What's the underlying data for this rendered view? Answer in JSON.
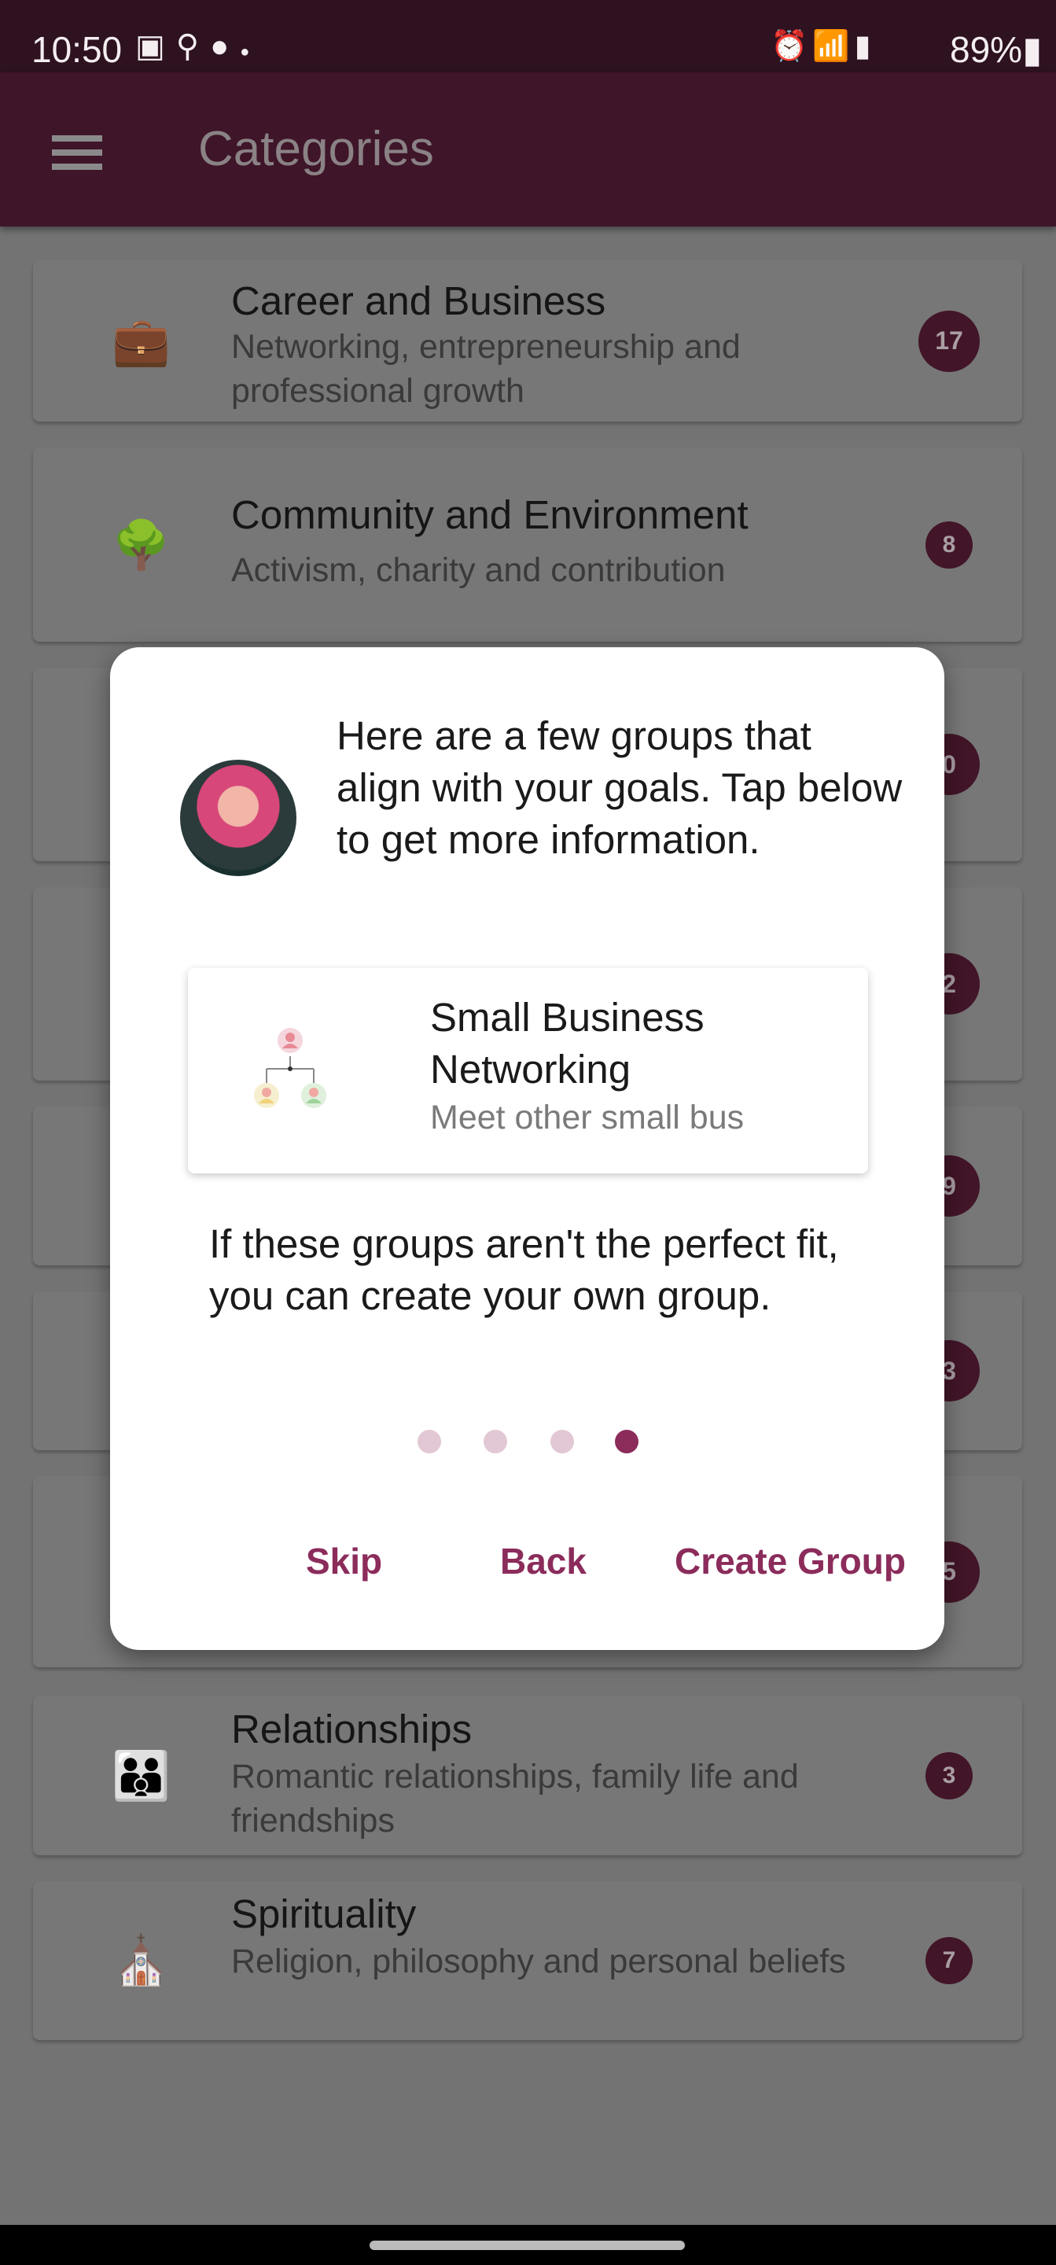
{
  "status_bar": {
    "time": "10:50",
    "battery": "89%",
    "left_icons": [
      "gallery-icon",
      "location-icon",
      "reddit-icon",
      "dot-icon"
    ],
    "right_icons": [
      "alarm-icon",
      "wifi-icon",
      "signal-icon",
      "battery-charging-icon"
    ]
  },
  "app_bar": {
    "title": "Categories",
    "menu_icon": "hamburger-icon"
  },
  "categories": [
    {
      "title": "Career and Business",
      "subtitle": "Networking, entrepreneurship and professional growth",
      "count": "17",
      "icon": "briefcase-icon"
    },
    {
      "title": "Community and Environment",
      "subtitle": "Activism, charity and contribution",
      "count": "8",
      "icon": "tree-person-icon"
    },
    {
      "count": "0",
      "icon": "graduation-cap-icon"
    },
    {
      "count": "2",
      "icon": "smiley-icon"
    },
    {
      "count": "9",
      "icon": "dollar-icon"
    },
    {
      "count": "3",
      "icon": "book-icon"
    },
    {
      "count": "5",
      "icon": "search-icon"
    },
    {
      "title": "Relationships",
      "subtitle": "Romantic relationships, family life and friendships",
      "count": "3",
      "icon": "family-icon"
    },
    {
      "title": "Spirituality",
      "subtitle": "Religion, philosophy and personal beliefs",
      "count": "7",
      "icon": "church-icon"
    }
  ],
  "dialog": {
    "intro": "Here are a few groups that align with your goals. Tap below to get more information.",
    "group": {
      "title": "Small Business Networking",
      "subtitle": "Meet other small bus"
    },
    "outro": "If these groups aren't the perfect fit, you can create your own group.",
    "pager": {
      "total": 4,
      "current": 4
    },
    "buttons": {
      "skip": "Skip",
      "back": "Back",
      "create": "Create Group"
    },
    "accent": "#8b2c5b"
  },
  "colors": {
    "app_bar": "#3f1529",
    "badge": "#421528"
  }
}
